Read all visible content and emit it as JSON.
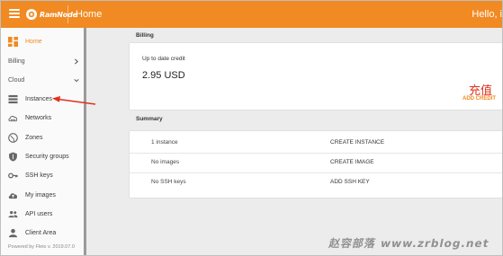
{
  "header": {
    "brand": "RamNode",
    "title": "Home",
    "user_greeting": "Hello, i"
  },
  "sidebar": {
    "items": [
      {
        "label": "Home",
        "icon": "dashboard-icon",
        "active": true
      },
      {
        "label": "Billing",
        "expandable": true
      },
      {
        "label": "Cloud",
        "expandable": true
      },
      {
        "label": "Instances",
        "icon": "server-stack-icon"
      },
      {
        "label": "Networks",
        "icon": "network-cloud-icon"
      },
      {
        "label": "Zones",
        "icon": "globe-icon"
      },
      {
        "label": "Security groups",
        "icon": "shield-icon"
      },
      {
        "label": "SSH keys",
        "icon": "key-icon"
      },
      {
        "label": "My images",
        "icon": "cloud-upload-icon"
      },
      {
        "label": "API users",
        "icon": "people-icon"
      },
      {
        "label": "Client Area",
        "icon": "person-icon"
      }
    ],
    "footer": "Powered by Fleio v. 2019.07.0"
  },
  "billing": {
    "section_title": "Billing",
    "credit_caption": "Up to date credit",
    "credit_value": "2.95 USD",
    "annotation": "充值",
    "add_credit_label": "ADD CREDIT"
  },
  "summary": {
    "section_title": "Summary",
    "rows": [
      {
        "label": "1 instance",
        "action": "CREATE INSTANCE"
      },
      {
        "label": "No images",
        "action": "CREATE IMAGE"
      },
      {
        "label": "No SSH keys",
        "action": "ADD SSH KEY"
      }
    ]
  },
  "watermark": "赵容部落 www.zrblog.net",
  "colors": {
    "brand_orange": "#f18a22",
    "annotation_red": "#e0301e",
    "sidebar_bg": "#fafafa",
    "page_bg": "#ececec"
  }
}
